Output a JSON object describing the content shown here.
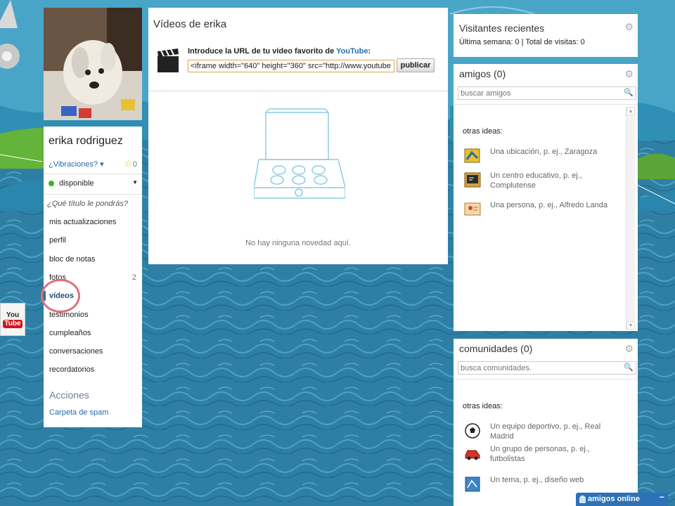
{
  "profile": {
    "name": "erika rodriguez",
    "vibration_link": "¿Vibraciones? ▾",
    "stars": "0",
    "status": "disponible",
    "title_prompt": "¿Qué título le pondrás?"
  },
  "nav": [
    {
      "label": "mis actualizaciones",
      "count": ""
    },
    {
      "label": "perfil",
      "count": ""
    },
    {
      "label": "bloc de notas",
      "count": ""
    },
    {
      "label": "fotos",
      "count": "2"
    },
    {
      "label": "vídeos",
      "count": ""
    },
    {
      "label": "testimonios",
      "count": ""
    },
    {
      "label": "cumpleaños",
      "count": ""
    },
    {
      "label": "conversaciones",
      "count": ""
    },
    {
      "label": "recordatorios",
      "count": ""
    }
  ],
  "actions": {
    "title": "Acciones",
    "spam_link": "Carpeta de spam"
  },
  "side_logo": {
    "you": "You",
    "tube": "Tube"
  },
  "videos": {
    "title": "Vídeos de erika",
    "url_prompt": "Introduce la URL de tu vídeo favorito de ",
    "url_prompt_brand": "YouTube",
    "url_prompt_end": ":",
    "url_value": "<iframe width=\"640\" height=\"360\" src=\"http://www.youtube.com",
    "publish_button": "publicar",
    "empty_message": "No hay ninguna novedad aquí."
  },
  "visitors": {
    "title": "Visitantes recientes",
    "stats": "Última semana: 0 | Total de visitas: 0"
  },
  "friends": {
    "title": "amigos (0)",
    "search_placeholder": "buscar amigos",
    "ideas_title": "otras ideas:",
    "ideas": [
      {
        "text": "Una ubicación, p. ej., Zaragoza",
        "icon": "map-icon"
      },
      {
        "text": "Un centro educativo, p. ej., Complutense",
        "icon": "chalkboard-icon"
      },
      {
        "text": "Una persona, p. ej., Alfredo Landa",
        "icon": "person-card-icon"
      }
    ]
  },
  "communities": {
    "title": "comunidades (0)",
    "search_placeholder": "busca comunidades.",
    "ideas_title": "otras ideas:",
    "ideas": [
      {
        "text": "Un equipo deportivo, p. ej., Real Madrid",
        "icon": "soccer-ball-icon"
      },
      {
        "text": "Un grupo de personas, p. ej., futbolistas",
        "icon": "car-icon"
      },
      {
        "text": "Un tema, p. ej., diseño web",
        "icon": "blueprint-icon"
      }
    ]
  },
  "chat": {
    "label": "amigos online",
    "minimize": "–"
  },
  "colors": {
    "link": "#2a6aa8",
    "accent_orange": "#e3a24a",
    "online_green": "#37b81f",
    "chat_bar": "#2d71b8",
    "highlight_circle": "#e06f7c"
  }
}
